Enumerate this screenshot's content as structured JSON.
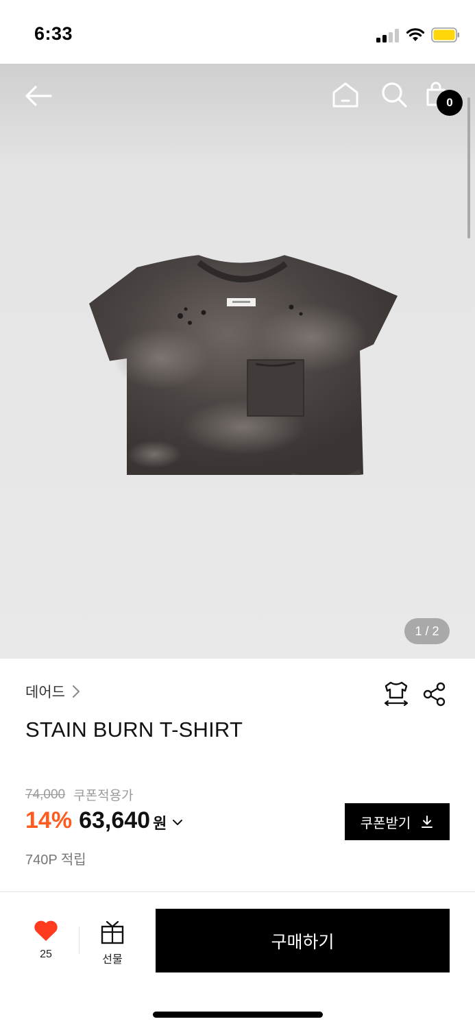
{
  "status_bar": {
    "time": "6:33",
    "icons": [
      "signal-icon",
      "wifi-icon",
      "battery-icon"
    ],
    "battery_color": "#FFD60A"
  },
  "header": {
    "icons": [
      "back-arrow-icon",
      "home-icon",
      "search-icon",
      "shopping-bag-icon"
    ],
    "cart_count": "0"
  },
  "gallery": {
    "image_description_icon": "t-shirt-image",
    "page_counter": "1 / 2"
  },
  "product": {
    "brand": "데어드",
    "name": "STAIN BURN T-SHIRT",
    "original_price": "74,000",
    "coupon_note": "쿠폰적용가",
    "discount": "14%",
    "price": "63,640",
    "currency": "원",
    "points": "740P 적립",
    "coupon_button": "쿠폰받기"
  },
  "bottom_bar": {
    "like_count": "25",
    "gift_label": "선물",
    "buy_label": "구매하기"
  },
  "colors": {
    "accent": "#FF5A1F",
    "black": "#000000",
    "hero_bg": "#E9E9E9"
  }
}
